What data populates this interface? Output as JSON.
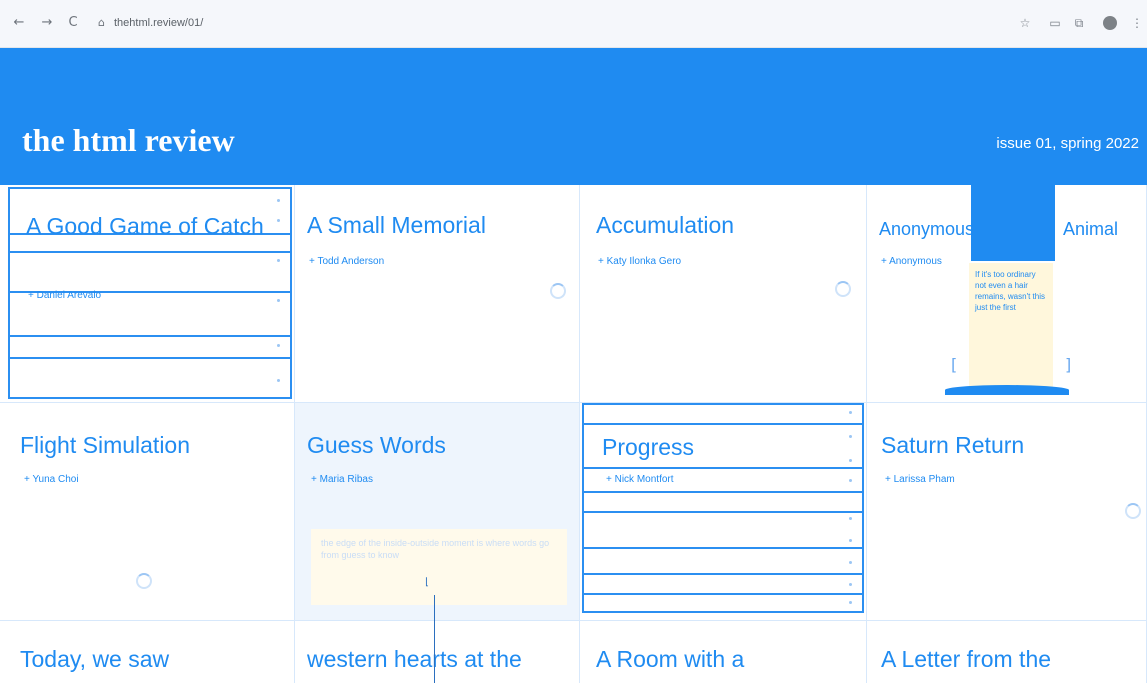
{
  "browser": {
    "back_icon": "←",
    "forward_icon": "→",
    "reload_icon": "C",
    "lock_icon": "⌂",
    "url": "thehtml.review/01/",
    "star_icon": "☆",
    "extensions_icon": "▭",
    "puzzle_icon": "⧉",
    "menu_icon": "⋮"
  },
  "header": {
    "title": "the html review",
    "issue": "issue 01, spring 2022",
    "color": "#1f8bf1"
  },
  "cards": [
    {
      "title": "A Good Game of Catch",
      "author": "+ Daniel Arevalo"
    },
    {
      "title": "A Small Memorial",
      "author": "+ Todd Anderson"
    },
    {
      "title": "Accumulation",
      "author": "+ Katy Ilonka Gero"
    },
    {
      "title": "Anonymous",
      "title_right": "Animal",
      "author": "+ Anonymous",
      "note": "If it's too ordinary not even a hair remains, wasn't this just the first"
    },
    {
      "title": "Flight Simulation",
      "author": "+ Yuna Choi"
    },
    {
      "title": "Guess Words",
      "author": "+ Maria Ribas",
      "note": "the edge of the inside-outside moment is where words go from guess to know"
    },
    {
      "title": "Progress",
      "author": "+ Nick Montfort"
    },
    {
      "title": "Saturn Return",
      "author": "+ Larissa Pham"
    },
    {
      "title": "Today, we saw"
    },
    {
      "title": "western hearts at the"
    },
    {
      "title": "A Room with a"
    },
    {
      "title": "A Letter from the"
    }
  ]
}
